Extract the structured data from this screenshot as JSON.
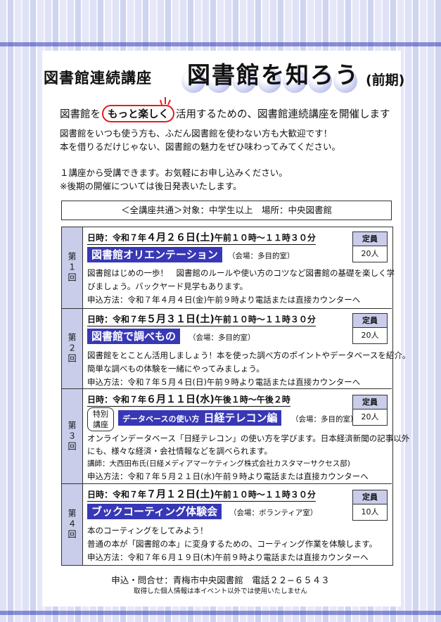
{
  "header": {
    "series_label": "図書館連続講座",
    "title": "図書館を知ろう",
    "term": "(前期)"
  },
  "lead": {
    "before": "図書館を",
    "highlight": "もっと楽しく",
    "after": "活用するための、図書館連続講座を開催します"
  },
  "intro_lines": [
    "図書館をいつも使う方も、ふだん図書館を使わない方も大歓迎です！",
    "本を借りるだけじゃない、図書館の魅力をぜひ味わってみてください。",
    "１講座から受講できます。お気軽にお申し込みください。",
    "※後期の開催については後日発表いたします。"
  ],
  "common_info": "＜全講座共通＞対象：中学生以上　場所：中央図書館",
  "capacity_label": "定員",
  "sessions": [
    {
      "number": "第１回",
      "date_prefix": "日時：令和７年",
      "date_main": "４月２６日(土)",
      "time": "午前１０時〜１１時３０分",
      "course": "図書館オリエンテーション",
      "venue": "（会場：多目的室）",
      "capacity": "20人",
      "desc": [
        "図書館はじめの一歩！　図書館のルールや使い方のコツなど図書館の基礎を楽しく学",
        "びましょう。バックヤード見学もあります。",
        "申込方法：令和７年４月４日(金)午前９時より電話または直接カウンターへ"
      ]
    },
    {
      "number": "第２回",
      "date_prefix": "日時：令和７年",
      "date_main": "５月３１日(土)",
      "time": "午前１０時〜１１時３０分",
      "course": "図書館で調べもの",
      "venue": "（会場：多目的室）",
      "capacity": "20人",
      "desc": [
        "図書館をとことん活用しましょう！本を使った調べ方のポイントやデータベースを紹介。",
        "簡単な調べもの体験を一緒にやってみましょう。",
        "申込方法：令和７年５月４日(日)午前９時より電話または直接カウンターへ"
      ]
    },
    {
      "number": "第３回",
      "date_prefix": "日時：令和７年",
      "date_main": "６月１１日(水)",
      "time": "午後１時〜午後２時",
      "special": [
        "特別",
        "講座"
      ],
      "course_small": "データベースの使い方",
      "course": "日経テレコン編",
      "venue": "（会場：多目的室）",
      "capacity": "20人",
      "desc": [
        "オンラインデータベース「日経テレコン」の使い方を学びます。日本経済新聞の記事以外",
        "にも、様々な経済・会社情報などを調べられます。",
        "講師：大西田布氏(日経メディアマーケティング株式会社カスタマーサクセス部)",
        "申込方法：令和７年５月２１日(水)午前９時より電話または直接カウンターへ"
      ]
    },
    {
      "number": "第４回",
      "date_prefix": "日時：令和７年",
      "date_main": "７月１２日(土)",
      "time": "午前１０時〜１１時３０分",
      "course": "ブックコーティング体験会",
      "venue": "（会場：ボランティア室）",
      "capacity": "10人",
      "desc": [
        "本のコーティングをしてみよう！",
        "普通の本が「図書館の本」に変身するための、コーティング作業を体験します。",
        "申込方法：令和７年６月１９日(木)午前９時より電話または直接カウンターへ"
      ]
    }
  ],
  "footer": {
    "contact": "申込・問合せ：青梅市中央図書館　電話２２−６５４３",
    "privacy": "取得した個人情報は本イベント以外では使用いたしません"
  },
  "colors": {
    "accent": "#3838b6",
    "highlight_border": "#e02020",
    "label_bg": "#c9cdea"
  }
}
